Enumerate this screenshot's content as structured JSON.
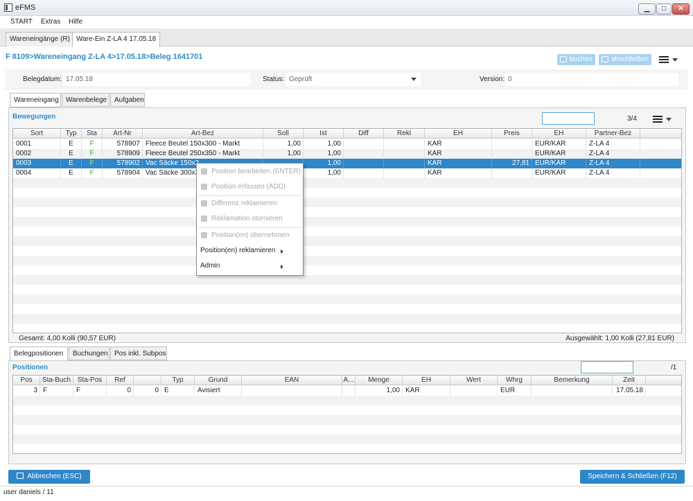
{
  "window": {
    "title": "eFMS",
    "btn_min": "▁",
    "btn_max": "□",
    "btn_close": "✕"
  },
  "menu": [
    "START",
    "Extras",
    "Hilfe"
  ],
  "doc_tabs": [
    "Wareneingänge (R)",
    "Ware-Ein Z-LA 4 17.05.18"
  ],
  "breadcrumb": "F 8109>Wareneingang Z-LA 4>17.05.18>Beleg 1641701",
  "actions": {
    "buchen": "buchen",
    "abschliessen": "abschließen"
  },
  "info": {
    "belegdatum_label": "Belegdatum:",
    "belegdatum": "17.05.18",
    "status_label": "Status:",
    "status": "Geprüft",
    "version_label": "Version:",
    "version": "0"
  },
  "tabs": [
    "Wareneingang",
    "Warenbelege",
    "Aufgaben"
  ],
  "bewegungen": {
    "title": "Bewegungen",
    "pager": "3/4",
    "columns": [
      "Sort",
      "Typ",
      "Sta",
      "Art-Nr",
      "Art-Bez",
      "Soll",
      "Ist",
      "Diff",
      "Rekl",
      "EH",
      "Preis",
      "EH",
      "Partner-Bez"
    ],
    "rows": [
      {
        "sort": "0001",
        "typ": "E",
        "sta": "F",
        "artnr": "578907",
        "artbez": "Fleece Beutel 150x300 - Markt",
        "soll": "1,00",
        "ist": "1,00",
        "eh": "KAR",
        "preis": "",
        "eh2": "EUR/KAR",
        "partner": "Z-LA 4"
      },
      {
        "sort": "0002",
        "typ": "E",
        "sta": "F",
        "artnr": "578909",
        "artbez": "Fleece Beutel 250x350 - Markt",
        "soll": "1,00",
        "ist": "1,00",
        "eh": "KAR",
        "preis": "",
        "eh2": "EUR/KAR",
        "partner": "Z-LA 4"
      },
      {
        "sort": "0003",
        "typ": "E",
        "sta": "F",
        "artnr": "578902",
        "artbez": "Vac Säcke 150x2",
        "soll": "",
        "ist": "1,00",
        "eh": "KAR",
        "preis": "27,81",
        "eh2": "EUR/KAR",
        "partner": "Z-LA 4"
      },
      {
        "sort": "0004",
        "typ": "E",
        "sta": "F",
        "artnr": "578904",
        "artbez": "Vac Säcke 300x35",
        "soll": "",
        "ist": "1,00",
        "eh": "KAR",
        "preis": "",
        "eh2": "EUR/KAR",
        "partner": "Z-LA 4"
      }
    ],
    "gesamt": "Gesamt: 4,00 Kolli (90,57 EUR)",
    "ausgewaehlt": "Ausgewählt: 1,00 Kolli (27,81 EUR)"
  },
  "context_menu": {
    "items": [
      "Position bearbeiten (ENTER)",
      "Position erfassen (ADD)",
      "Differenz reklamieren",
      "Reklamation stornieren",
      "Position(en) übernehmen",
      "Position(en) reklamieren",
      "Admin"
    ]
  },
  "tabs_bottom": [
    "Belegpositionen",
    "Buchungen",
    "Pos inkl. Subpos"
  ],
  "positionen": {
    "title": "Positionen",
    "pager": "/1",
    "columns": [
      "Pos",
      "Sta-Buch",
      "Sta-Pos",
      "Ref",
      "",
      "Typ",
      "Grund",
      "EAN",
      "A...",
      "Menge",
      "EH",
      "Wert",
      "Whrg",
      "Bemerkung",
      "Zeit"
    ],
    "rows": [
      {
        "pos": "3",
        "stabuch": "F",
        "stapos": "F",
        "ref": "0",
        "ref2": "0",
        "typ": "E",
        "grund": "Avisiert",
        "ean": "",
        "a": "",
        "menge": "1,00",
        "eh": "KAR",
        "wert": "",
        "whrg": "EUR",
        "bemerkung": "",
        "zeit": "17.05.18"
      }
    ]
  },
  "buttons": {
    "cancel": "Abbrechen (ESC)",
    "save": "Speichern & Schließen (F12)"
  },
  "status_bar": "user daniels / 11"
}
